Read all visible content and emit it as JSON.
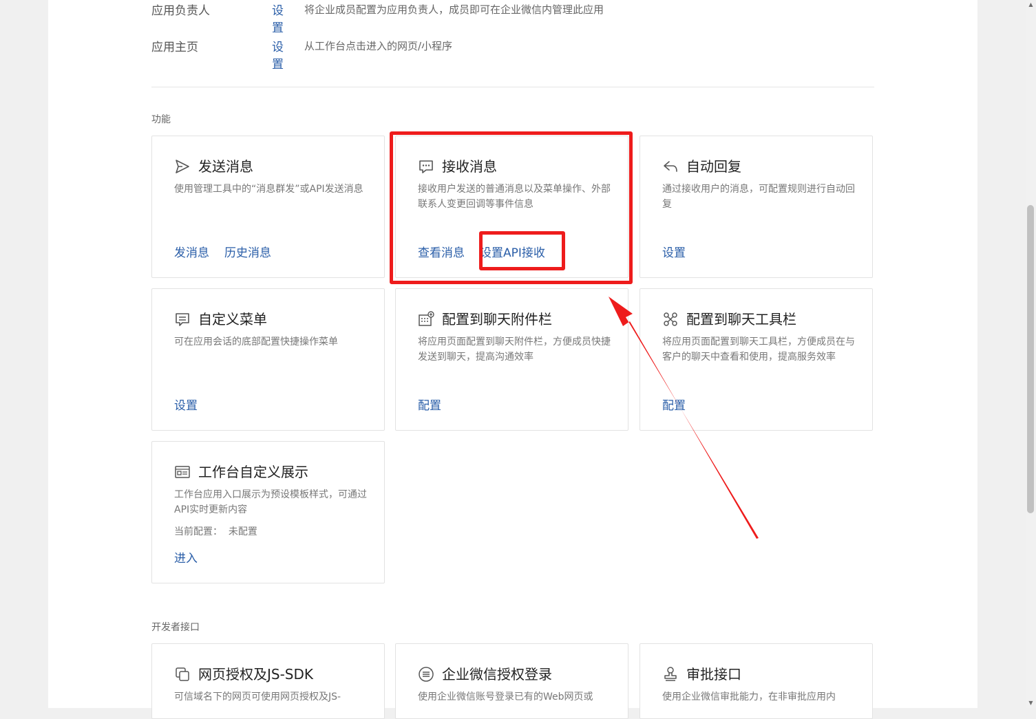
{
  "settings_rows": [
    {
      "label": "应用负责人",
      "link": "设置",
      "desc": "将企业成员配置为应用负责人，成员即可在企业微信内管理此应用"
    },
    {
      "label": "应用主页",
      "link": "设置",
      "desc": "从工作台点击进入的网页/小程序"
    }
  ],
  "sections": {
    "features": "功能",
    "developer": "开发者接口"
  },
  "cards": [
    {
      "title": "发送消息",
      "icon": "send-icon",
      "desc": "使用管理工具中的“消息群发”或API发送消息",
      "actions": [
        "发消息",
        "历史消息"
      ]
    },
    {
      "title": "接收消息",
      "icon": "chat-bubble-icon",
      "desc": "接收用户发送的普通消息以及菜单操作、外部联系人变更回调等事件信息",
      "actions": [
        "查看消息",
        "设置API接收"
      ]
    },
    {
      "title": "自动回复",
      "icon": "reply-icon",
      "desc": "通过接收用户的消息，可配置规则进行自动回复",
      "actions": [
        "设置"
      ]
    },
    {
      "title": "自定义菜单",
      "icon": "menu-icon",
      "desc": "可在应用会话的底部配置快捷操作菜单",
      "actions": [
        "设置"
      ]
    },
    {
      "title": "配置到聊天附件栏",
      "icon": "attachment-bar-icon",
      "desc": "将应用页面配置到聊天附件栏，方便成员快捷发送到聊天，提高沟通效率",
      "actions": [
        "配置"
      ]
    },
    {
      "title": "配置到聊天工具栏",
      "icon": "toolbar-icon",
      "desc": "将应用页面配置到聊天工具栏，方便成员在与客户的聊天中查看和使用，提高服务效率",
      "actions": [
        "配置"
      ]
    },
    {
      "title": "工作台自定义展示",
      "icon": "workbench-icon",
      "desc": "工作台应用入口展示为预设模板样式，可通过API实时更新内容",
      "meta_label": "当前配置：",
      "meta_value": "未配置",
      "actions": [
        "进入"
      ]
    },
    {
      "title": "网页授权及JS-SDK",
      "icon": "web-auth-icon",
      "desc": "可信域名下的网页可使用网页授权及JS-",
      "actions": []
    },
    {
      "title": "企业微信授权登录",
      "icon": "login-icon",
      "desc": "使用企业微信账号登录已有的Web网页或",
      "actions": []
    },
    {
      "title": "审批接口",
      "icon": "approval-stamp-icon",
      "desc": "使用企业微信审批能力，在非审批应用内",
      "actions": []
    }
  ],
  "colors": {
    "link": "#2a5ea8",
    "highlight": "#ee1c1c"
  }
}
